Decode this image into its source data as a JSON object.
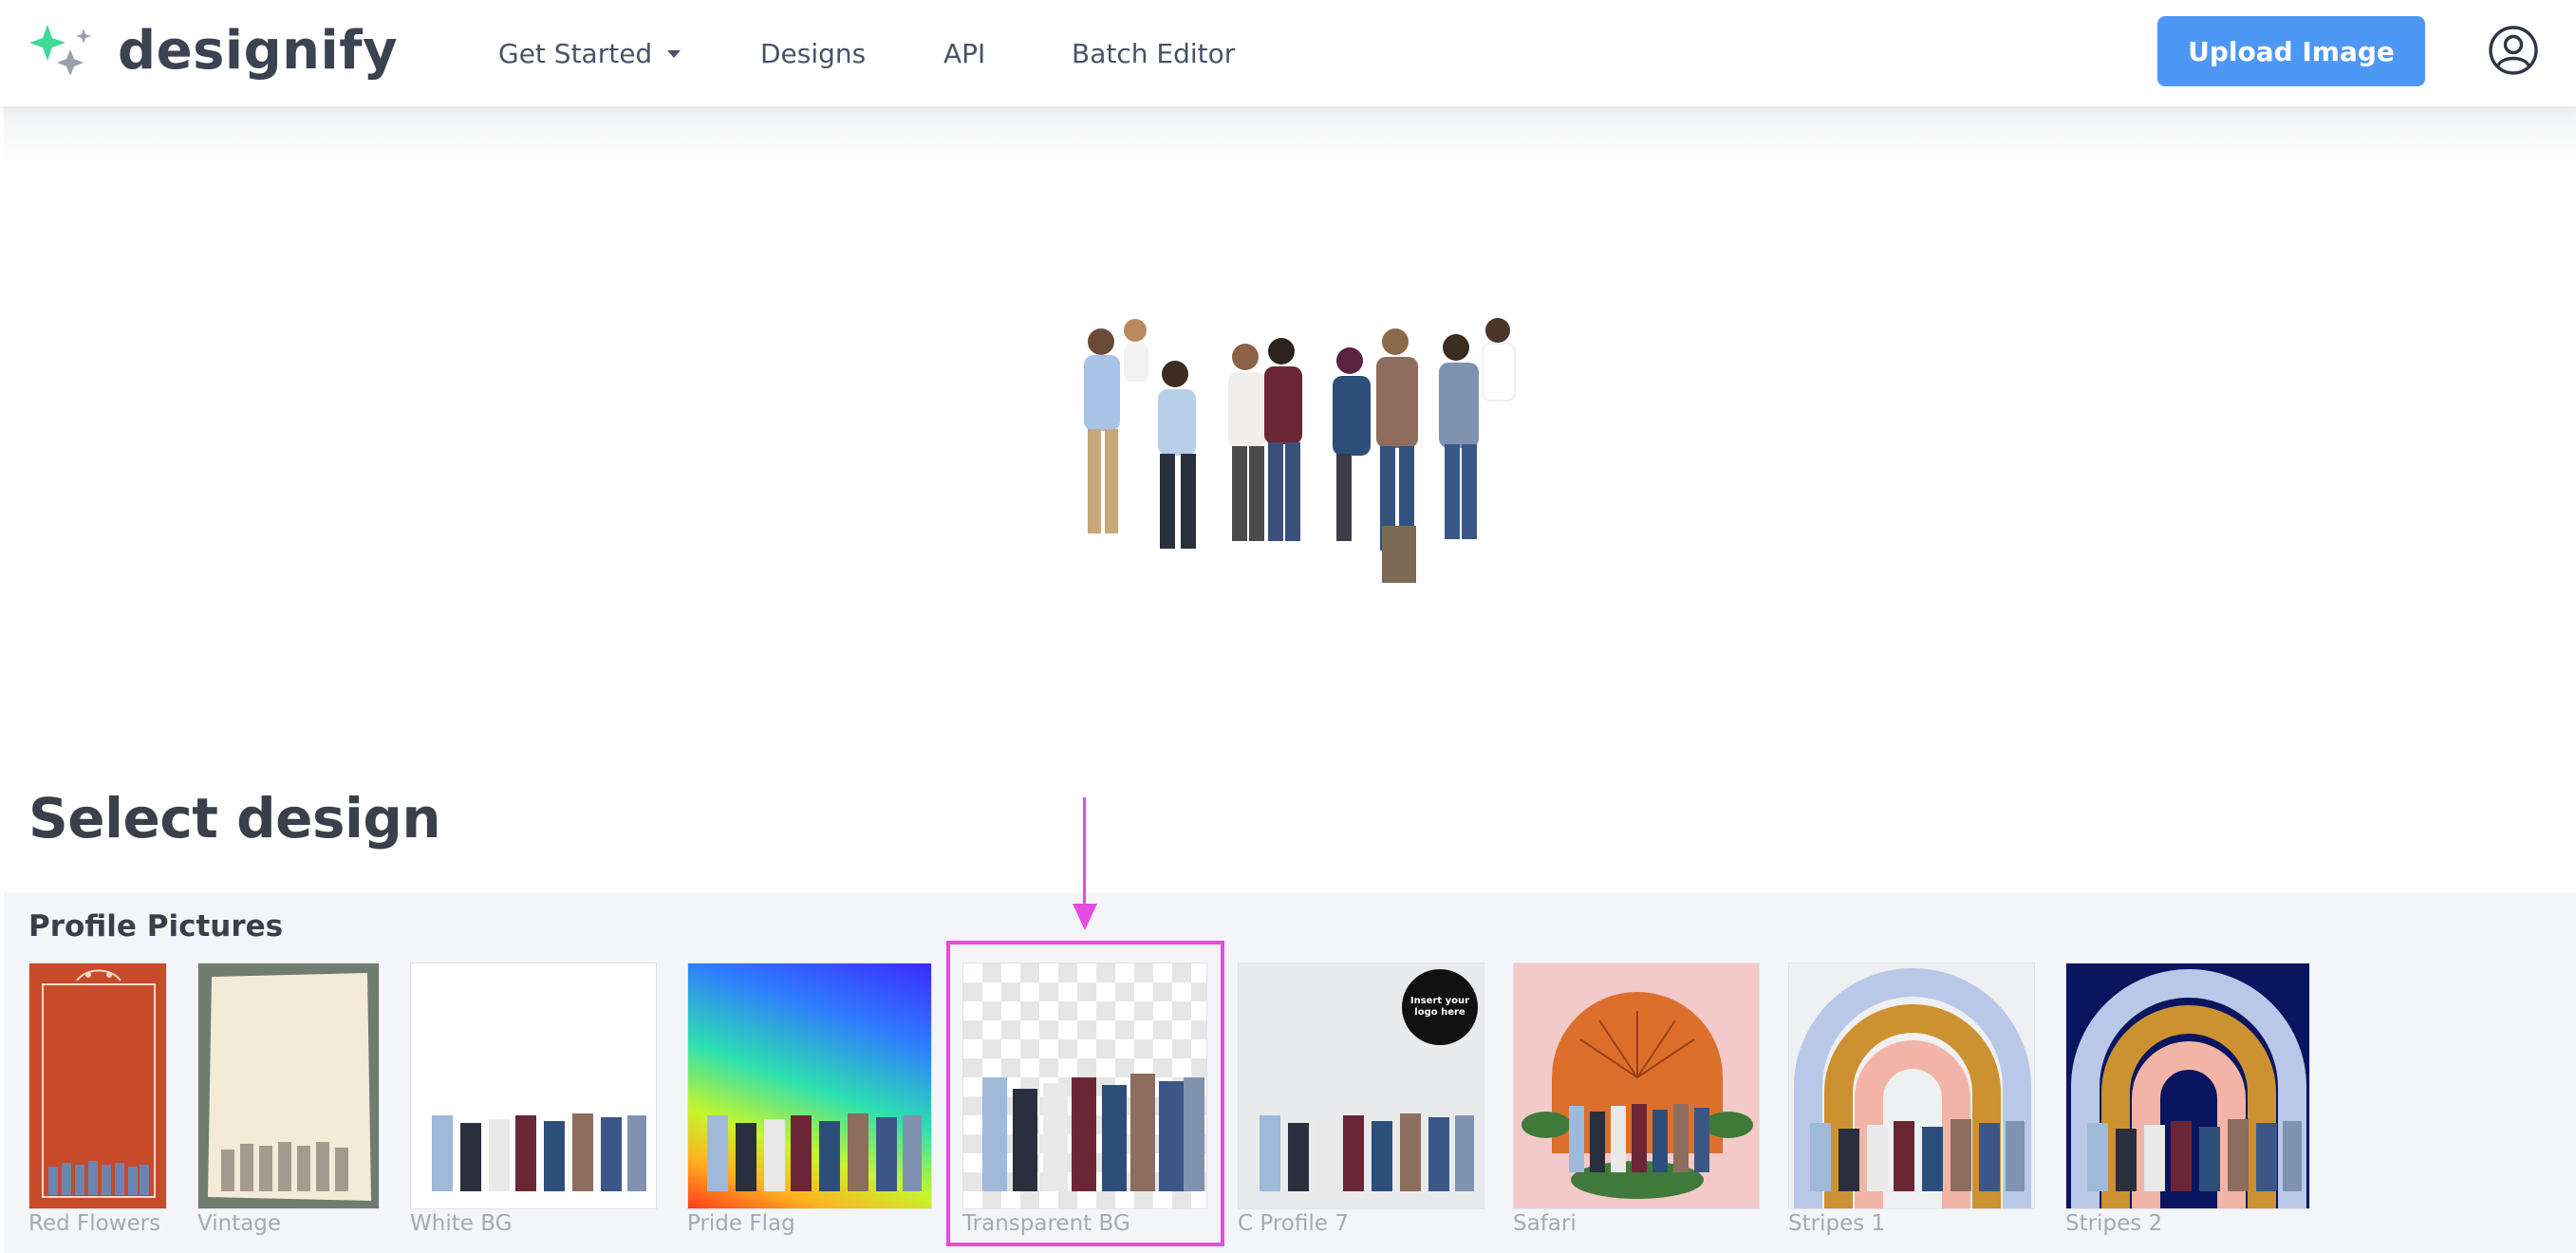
{
  "brand": {
    "name": "designify",
    "accent": "#4e98f5",
    "logo_green": "#3fd99a",
    "logo_grey": "#9aa1ae"
  },
  "nav": {
    "get_started": "Get Started",
    "designs": "Designs",
    "api": "API",
    "batch_editor": "Batch Editor"
  },
  "header": {
    "upload_label": "Upload Image",
    "account_icon": "user-circle-icon"
  },
  "main": {
    "select_title": "Select design"
  },
  "designs": {
    "section_label": "Profile Pictures",
    "highlight_color": "#e44be2",
    "items": [
      {
        "label": "Red Flowers",
        "background": "#c74a2b"
      },
      {
        "label": "Vintage",
        "background": "#6f7c6e"
      },
      {
        "label": "White BG",
        "background": "#ffffff"
      },
      {
        "label": "Pride Flag",
        "background": "rainbow-gradient"
      },
      {
        "label": "Transparent BG",
        "background": "checkerboard",
        "selected": true
      },
      {
        "label": "C Profile 7",
        "background": "#e9eaec",
        "badge": "Insert your logo here"
      },
      {
        "label": "Safari",
        "background": "#f4c9c9"
      },
      {
        "label": "Stripes 1",
        "background": "#eef0f2"
      },
      {
        "label": "Stripes 2",
        "background": "#0a1560"
      }
    ]
  }
}
